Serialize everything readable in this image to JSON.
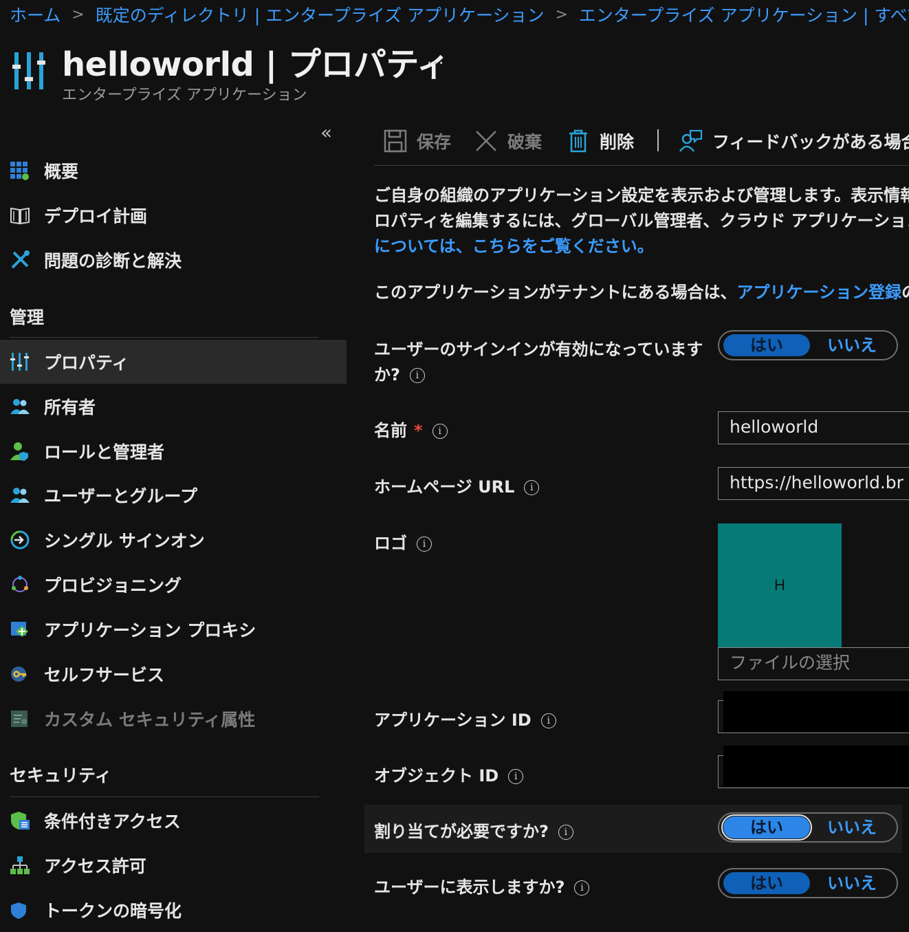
{
  "breadcrumb": {
    "items": [
      "ホーム",
      "既定のディレクトリ | エンタープライズ アプリケーション",
      "エンタープライズ アプリケーション | すべての"
    ],
    "separator": ">"
  },
  "header": {
    "title": "helloworld | プロパティ",
    "subtitle": "エンタープライズ アプリケーション",
    "more": "…"
  },
  "sidebar": {
    "collapse": "«",
    "items": [
      {
        "label": "概要",
        "icon": "overview-grid-icon"
      },
      {
        "label": "デプロイ計画",
        "icon": "book-icon"
      },
      {
        "label": "問題の診断と解決",
        "icon": "wrench-icon"
      }
    ],
    "sections": [
      {
        "title": "管理",
        "items": [
          {
            "label": "プロパティ",
            "icon": "properties-sliders-icon",
            "active": true
          },
          {
            "label": "所有者",
            "icon": "owners-people-icon"
          },
          {
            "label": "ロールと管理者",
            "icon": "roles-admin-icon"
          },
          {
            "label": "ユーザーとグループ",
            "icon": "users-groups-icon"
          },
          {
            "label": "シングル サインオン",
            "icon": "single-sign-on-icon"
          },
          {
            "label": "プロビジョニング",
            "icon": "provisioning-icon"
          },
          {
            "label": "アプリケーション プロキシ",
            "icon": "app-proxy-icon"
          },
          {
            "label": "セルフサービス",
            "icon": "self-service-key-icon"
          },
          {
            "label": "カスタム セキュリティ属性",
            "icon": "custom-attributes-icon",
            "disabled": true
          }
        ]
      },
      {
        "title": "セキュリティ",
        "items": [
          {
            "label": "条件付きアクセス",
            "icon": "conditional-access-shield-icon"
          },
          {
            "label": "アクセス許可",
            "icon": "permissions-tree-icon"
          },
          {
            "label": "トークンの暗号化",
            "icon": "token-encryption-icon"
          }
        ]
      }
    ]
  },
  "toolbar": {
    "save": "保存",
    "discard": "破棄",
    "delete": "削除",
    "feedback": "フィードバックがある場合"
  },
  "description": {
    "line1": "ご自身の組織のアプリケーション設定を表示および管理します。表示情報",
    "line2": "ロパティを編集するには、グローバル管理者、クラウド アプリケーション管",
    "line3_link": "については、こちらをご覧ください。",
    "line4_pre": "このアプリケーションがテナントにある場合は、",
    "line4_link": "アプリケーション登録",
    "line4_post": "の追加"
  },
  "form": {
    "sign_in_enabled": {
      "label_line1": "ユーザーのサインインが有効になっています",
      "label_line2": "か?",
      "yes": "はい",
      "no": "いいえ",
      "value": "はい"
    },
    "name": {
      "label": "名前",
      "required": "*",
      "value": "helloworld"
    },
    "homepage_url": {
      "label": "ホームページ URL",
      "value": "https://helloworld.br"
    },
    "logo": {
      "label": "ロゴ",
      "letter": "H",
      "file_placeholder": "ファイルの選択",
      "color": "#067a76"
    },
    "application_id": {
      "label": "アプリケーション ID"
    },
    "object_id": {
      "label": "オブジェクト ID"
    },
    "assignment_required": {
      "label": "割り当てが必要ですか?",
      "yes": "はい",
      "no": "いいえ",
      "value": "はい"
    },
    "visible_to_users": {
      "label": "ユーザーに表示しますか?",
      "yes": "はい",
      "no": "いいえ",
      "value": "はい"
    }
  },
  "info_glyph": "i",
  "colors": {
    "accent": "#3c9cff",
    "toggle_selected": "#0f60b6",
    "logo_bg": "#067a76",
    "required": "#e8453c"
  }
}
